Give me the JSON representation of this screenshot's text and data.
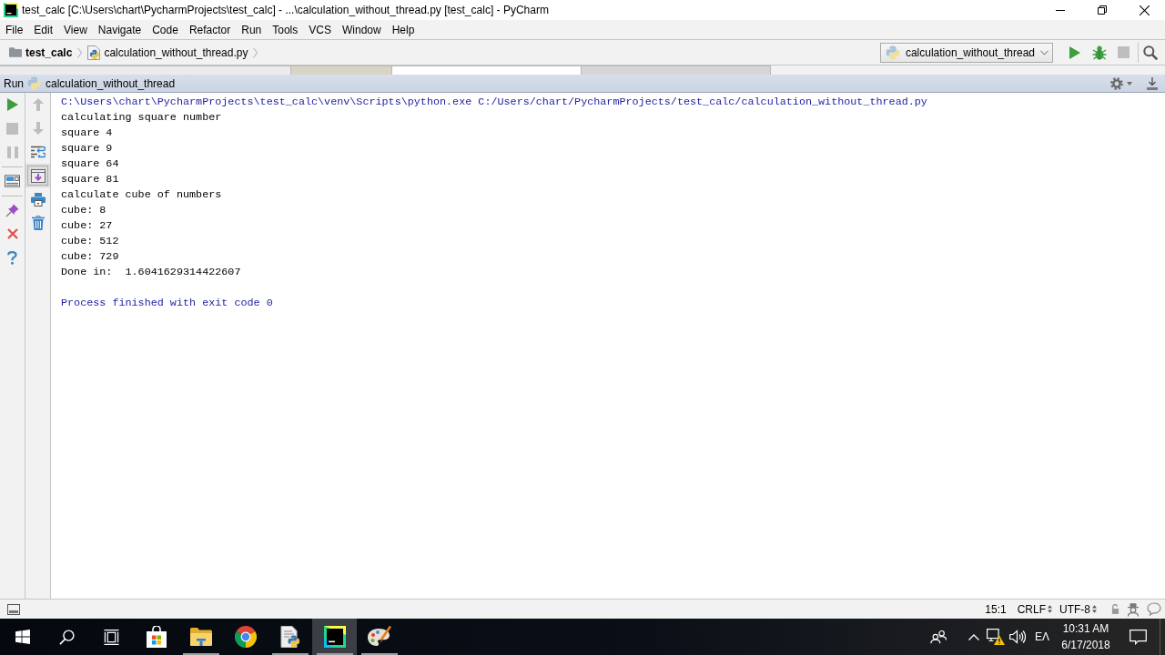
{
  "window": {
    "title": "test_calc [C:\\Users\\chart\\PycharmProjects\\test_calc] - ...\\calculation_without_thread.py [test_calc] - PyCharm"
  },
  "menu": [
    {
      "label": "File"
    },
    {
      "label": "Edit"
    },
    {
      "label": "View"
    },
    {
      "label": "Navigate"
    },
    {
      "label": "Code"
    },
    {
      "label": "Refactor"
    },
    {
      "label": "Run"
    },
    {
      "label": "Tools"
    },
    {
      "label": "VCS"
    },
    {
      "label": "Window"
    },
    {
      "label": "Help"
    }
  ],
  "navbar": {
    "breadcrumbs": [
      {
        "kind": "project",
        "label": "test_calc"
      },
      {
        "kind": "file",
        "label": "calculation_without_thread.py"
      }
    ],
    "run_config": "calculation_without_thread",
    "tools": [
      {
        "kind": "run",
        "disabled": false
      },
      {
        "kind": "debug",
        "disabled": false
      },
      {
        "kind": "stop",
        "disabled": true
      },
      {
        "kind": "search",
        "disabled": false
      }
    ]
  },
  "run_panel": {
    "label": "Run",
    "config": "calculation_without_thread",
    "left_tool_groups": [
      [
        {
          "kind": "rerun",
          "disabled": false
        },
        {
          "kind": "stop",
          "disabled": true
        },
        {
          "kind": "pause",
          "disabled": true
        }
      ],
      [
        {
          "kind": "layout",
          "disabled": false
        }
      ],
      [
        {
          "kind": "pin",
          "disabled": false
        },
        {
          "kind": "close",
          "disabled": false
        },
        {
          "kind": "help",
          "disabled": false
        }
      ]
    ],
    "right_tools": [
      {
        "kind": "up",
        "disabled": true,
        "selected": false
      },
      {
        "kind": "down",
        "disabled": true,
        "selected": false
      },
      {
        "kind": "soft_wrap",
        "disabled": false,
        "selected": false
      },
      {
        "kind": "scroll_to_end",
        "disabled": false,
        "selected": true
      },
      {
        "kind": "print",
        "disabled": false,
        "selected": false
      },
      {
        "kind": "clear",
        "disabled": false,
        "selected": false
      }
    ]
  },
  "console": {
    "lines": [
      {
        "kind": "system",
        "text": "C:\\Users\\chart\\PycharmProjects\\test_calc\\venv\\Scripts\\python.exe C:/Users/chart/PycharmProjects/test_calc/calculation_without_thread.py"
      },
      {
        "kind": "stdout",
        "text": "calculating square number"
      },
      {
        "kind": "stdout",
        "text": "square 4"
      },
      {
        "kind": "stdout",
        "text": "square 9"
      },
      {
        "kind": "stdout",
        "text": "square 64"
      },
      {
        "kind": "stdout",
        "text": "square 81"
      },
      {
        "kind": "stdout",
        "text": "calculate cube of numbers"
      },
      {
        "kind": "stdout",
        "text": "cube: 8"
      },
      {
        "kind": "stdout",
        "text": "cube: 27"
      },
      {
        "kind": "stdout",
        "text": "cube: 512"
      },
      {
        "kind": "stdout",
        "text": "cube: 729"
      },
      {
        "kind": "stdout",
        "text": "Done in:  1.6041629314422607"
      },
      {
        "kind": "blank"
      },
      {
        "kind": "system",
        "text": "Process finished with exit code 0"
      }
    ]
  },
  "status_bar": {
    "position": "15:1",
    "line_separator": "CRLF",
    "encoding": "UTF-8"
  },
  "taskbar": {
    "buttons": [
      {
        "kind": "start"
      },
      {
        "kind": "search"
      },
      {
        "kind": "task_view"
      }
    ],
    "apps": [
      {
        "kind": "store",
        "running": false,
        "selected": false
      },
      {
        "kind": "explorer",
        "running": true,
        "selected": false
      },
      {
        "kind": "browser",
        "running": false,
        "selected": false
      },
      {
        "kind": "python_file",
        "running": true,
        "selected": false
      },
      {
        "kind": "ide",
        "running": true,
        "selected": true
      },
      {
        "kind": "paint",
        "running": true,
        "selected": false
      }
    ],
    "language": "ΕΛ",
    "time": "10:31 AM",
    "date": "6/17/2018"
  }
}
